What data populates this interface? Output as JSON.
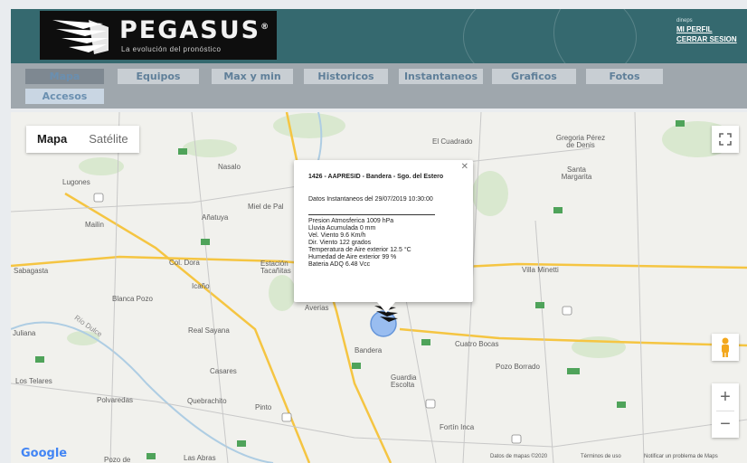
{
  "header": {
    "brand": "PEGASUS",
    "brand_mark": "®",
    "tagline": "La evolución del pronóstico",
    "username": "dineps",
    "links": {
      "profile": "MI PERFIL",
      "logout": "CERRAR SESION"
    }
  },
  "nav": {
    "items": [
      {
        "label": "Mapa",
        "active": true
      },
      {
        "label": "Equipos"
      },
      {
        "label": "Max y min"
      },
      {
        "label": "Historicos"
      },
      {
        "label": "Instantaneos"
      },
      {
        "label": "Graficos"
      },
      {
        "label": "Fotos"
      }
    ],
    "second_row": [
      {
        "label": "Accesos"
      }
    ]
  },
  "map": {
    "type_control": {
      "map": "Mapa",
      "satellite": "Satélite"
    },
    "fullscreen_icon": "fullscreen-icon",
    "zoom_in": "+",
    "zoom_out": "−",
    "places": [
      "Nasalo",
      "Lugones",
      "Mailin",
      "Añatuya",
      "Miel de Pal",
      "El Cuadrado",
      "Gregoria Pérez de Denis",
      "Santa Margarita",
      "Sabagasta",
      "Col. Dora",
      "Estación Tacañitas",
      "Icaño",
      "Blanca Pozo",
      "Averias",
      "Villa Minetti",
      "Juliana",
      "Río Dulce",
      "Real Sayana",
      "Bandera",
      "Cuatro Bocas",
      "Pozo Borrado",
      "Los Telares",
      "Casares",
      "Guardia Escolta",
      "Polvaredas",
      "Quebrachito",
      "Pinto",
      "Fortín Inca",
      "Las Abras",
      "Pozo de"
    ],
    "popup": {
      "title": "1426 - AAPRESID - Bandera - Sgo. del Estero",
      "date": "Datos Instantaneos del 29/07/2019 10:30:00",
      "lines": [
        "Presion Atmosferica 1009 hPa",
        "Lluvia Acumulada 0 mm",
        "Vel. Viento 9.6 Km/h",
        "Dir. Viento 122 grados",
        "Temperatura de Aire exterior 12.5 °C",
        "Humedad de Aire exterior 99 %",
        "Bateria ADQ 6.48 Vcc"
      ]
    },
    "footer": {
      "data": "Datos de mapas ©2020",
      "terms": "Términos de uso",
      "report": "Notificar un problema de Maps",
      "google": "Google"
    }
  },
  "colors": {
    "header_bg": "#35696f",
    "nav_bg": "#9fa7ad",
    "nav_tab": "#c8ced3",
    "nav_text": "#5f7f99",
    "road": "#f5c542",
    "map_bg": "#f1f1ed"
  }
}
